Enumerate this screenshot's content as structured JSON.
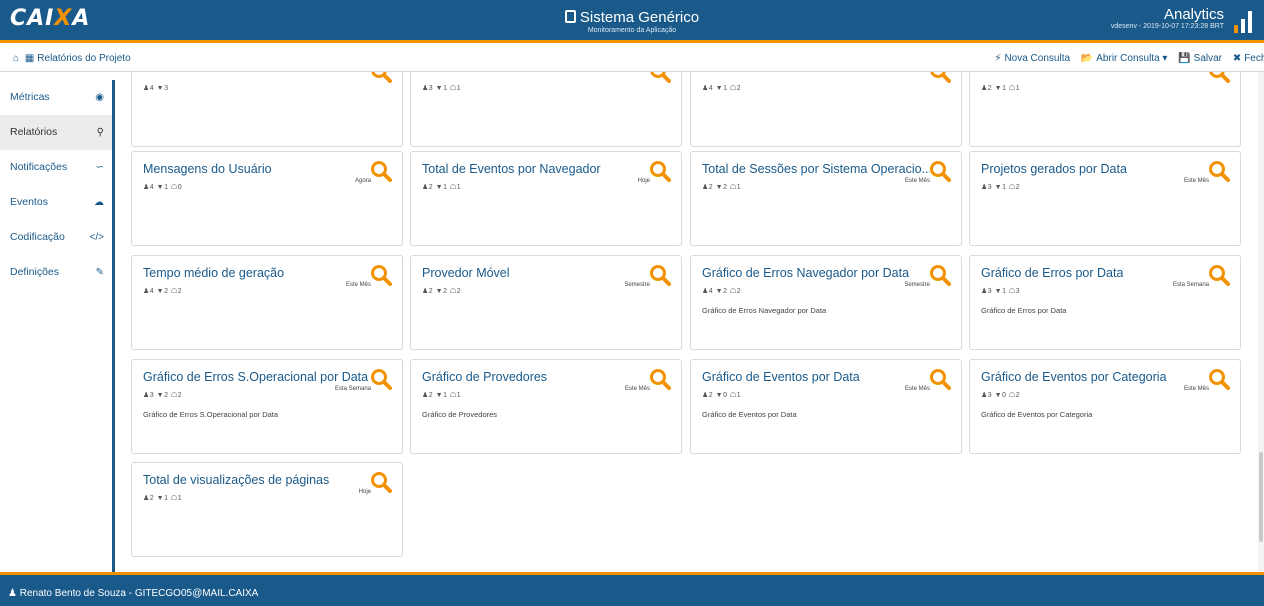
{
  "header": {
    "logo_main": "CAI",
    "logo_x": "X",
    "logo_end": "A",
    "title": "Sistema Genérico",
    "subtitle": "Monitoramento da Aplicação",
    "brand": "Analytics",
    "env_info": "vdesenv - 2019-10-07 17:23:28 BRT"
  },
  "toolbar": {
    "breadcrumb": "Relatórios do Projeto",
    "actions": [
      {
        "label": "Nova Consulta",
        "icon": "plug-icon"
      },
      {
        "label": "Abrir Consulta",
        "icon": "folder-open-icon"
      },
      {
        "label": "Salvar",
        "icon": "save-icon"
      },
      {
        "label": "Fecha",
        "icon": "close-icon"
      }
    ]
  },
  "sidebar": {
    "items": [
      {
        "label": "Métricas",
        "icon": "dashboard-icon"
      },
      {
        "label": "Relatórios",
        "icon": "search-icon"
      },
      {
        "label": "Notificações",
        "icon": "rss-icon"
      },
      {
        "label": "Eventos",
        "icon": "cloud-icon"
      },
      {
        "label": "Codificação",
        "icon": "code-icon"
      },
      {
        "label": "Definições",
        "icon": "edit-icon"
      }
    ]
  },
  "cards": [
    {
      "title": "",
      "meta": "4 3",
      "period": "",
      "desc": ""
    },
    {
      "title": "",
      "meta": "3 1 1",
      "period": "",
      "desc": ""
    },
    {
      "title": "",
      "meta": "4 1 2",
      "period": "",
      "desc": ""
    },
    {
      "title": "",
      "meta": "2 1 1",
      "period": "",
      "desc": ""
    },
    {
      "title": "Mensagens do Usuário",
      "meta": "4 1 0",
      "period": "Agora",
      "desc": ""
    },
    {
      "title": "Total de Eventos por Navegador",
      "meta": "2 1 1",
      "period": "Hoje",
      "desc": ""
    },
    {
      "title": "Total de Sessões por Sistema Operacio...",
      "meta": "2 2 1",
      "period": "Este Mês",
      "desc": ""
    },
    {
      "title": "Projetos gerados por Data",
      "meta": "3 1 2",
      "period": "Este Mês",
      "desc": ""
    },
    {
      "title": "Tempo médio de geração",
      "meta": "4 2 2",
      "period": "Este Mês",
      "desc": ""
    },
    {
      "title": "Provedor Móvel",
      "meta": "2 2 2",
      "period": "Semestre",
      "desc": ""
    },
    {
      "title": "Gráfico de Erros Navegador por Data",
      "meta": "4 2 2",
      "period": "Semestre",
      "desc": "Gráfico de Erros Navegador por Data"
    },
    {
      "title": "Gráfico de Erros por Data",
      "meta": "3 1 3",
      "period": "Esta Semana",
      "desc": "Gráfico de Erros por Data"
    },
    {
      "title": "Gráfico de Erros S.Operacional por Data",
      "meta": "3 2 2",
      "period": "Esta Semana",
      "desc": "Gráfico de Erros S.Operacional por Data"
    },
    {
      "title": "Gráfico de Provedores",
      "meta": "2 1 1",
      "period": "Este Mês",
      "desc": "Gráfico de Provedores"
    },
    {
      "title": "Gráfico de Eventos por Data",
      "meta": "2 0 1",
      "period": "Este Mês",
      "desc": "Gráfico de Eventos por Data"
    },
    {
      "title": "Gráfico de Eventos por Categoria",
      "meta": "3 0 2",
      "period": "Este Mês",
      "desc": "Gráfico de Eventos por Categoria"
    },
    {
      "title": "Total de visualizações de páginas",
      "meta": "2 1 1",
      "period": "Hoje",
      "desc": ""
    }
  ],
  "footer": {
    "user": "Renato Bento de Souza  - GITECGO05@MAIL.CAIXA"
  },
  "colors": {
    "primary": "#1a5a8a",
    "accent": "#f39200"
  }
}
